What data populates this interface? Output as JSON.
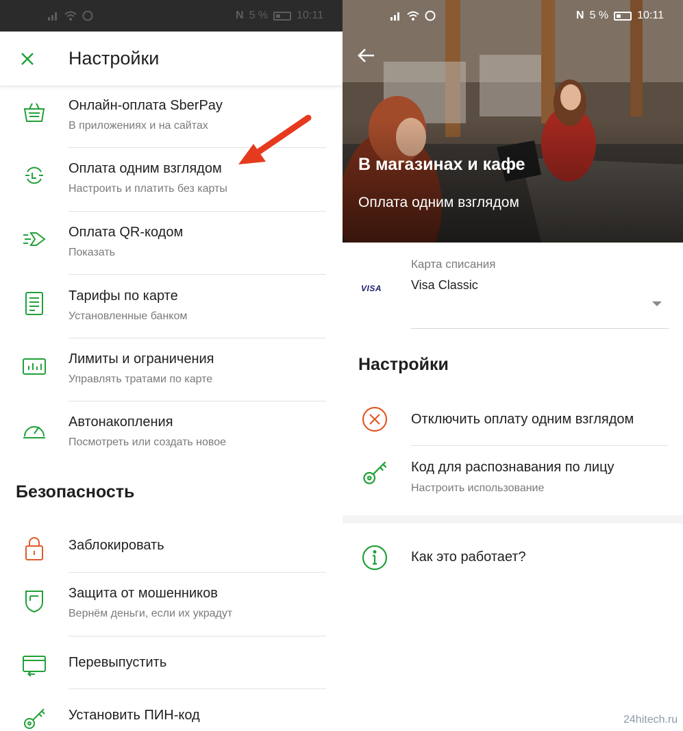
{
  "status_left": {
    "battery": "5 %",
    "time": "10:11"
  },
  "status_right": {
    "battery": "5 %",
    "time": "10:11"
  },
  "left": {
    "title": "Настройки",
    "items": [
      {
        "title": "Онлайн-оплата SberPay",
        "sub": "В приложениях и на сайтах",
        "icon": "basket-icon"
      },
      {
        "title": "Оплата одним взглядом",
        "sub": "Настроить и платить без карты",
        "icon": "face-pay-icon"
      },
      {
        "title": "Оплата QR-кодом",
        "sub": "Показать",
        "icon": "qr-arrow-icon"
      },
      {
        "title": "Тарифы по карте",
        "sub": "Установленные банком",
        "icon": "document-icon"
      },
      {
        "title": "Лимиты и ограничения",
        "sub": "Управлять тратами по карте",
        "icon": "chart-icon"
      },
      {
        "title": "Автонакопления",
        "sub": "Посмотреть или создать новое",
        "icon": "gauge-icon"
      }
    ],
    "security_title": "Безопасность",
    "security_items": [
      {
        "title": "Заблокировать",
        "sub": "",
        "icon": "lock-icon"
      },
      {
        "title": "Защита от мошенников",
        "sub": "Вернём деньги, если их украдут",
        "icon": "shield-icon"
      },
      {
        "title": "Перевыпустить",
        "sub": "",
        "icon": "reissue-icon"
      },
      {
        "title": "Установить ПИН-код",
        "sub": "",
        "icon": "key-icon"
      }
    ]
  },
  "right": {
    "hero_title": "В магазинах и кафе",
    "hero_sub": "Оплата одним взглядом",
    "card_label": "Карта списания",
    "card_brand": "VISA",
    "card_value": "Visa Classic",
    "settings_title": "Настройки",
    "disable_label": "Отключить оплату одним взглядом",
    "face_code_title": "Код для распознавания по лицу",
    "face_code_sub": "Настроить использование",
    "how_label": "Как это работает?"
  },
  "watermark": "24hitech.ru",
  "colors": {
    "accent": "#21a038",
    "danger": "#e05a2a",
    "arrow": "#e63a1e"
  }
}
